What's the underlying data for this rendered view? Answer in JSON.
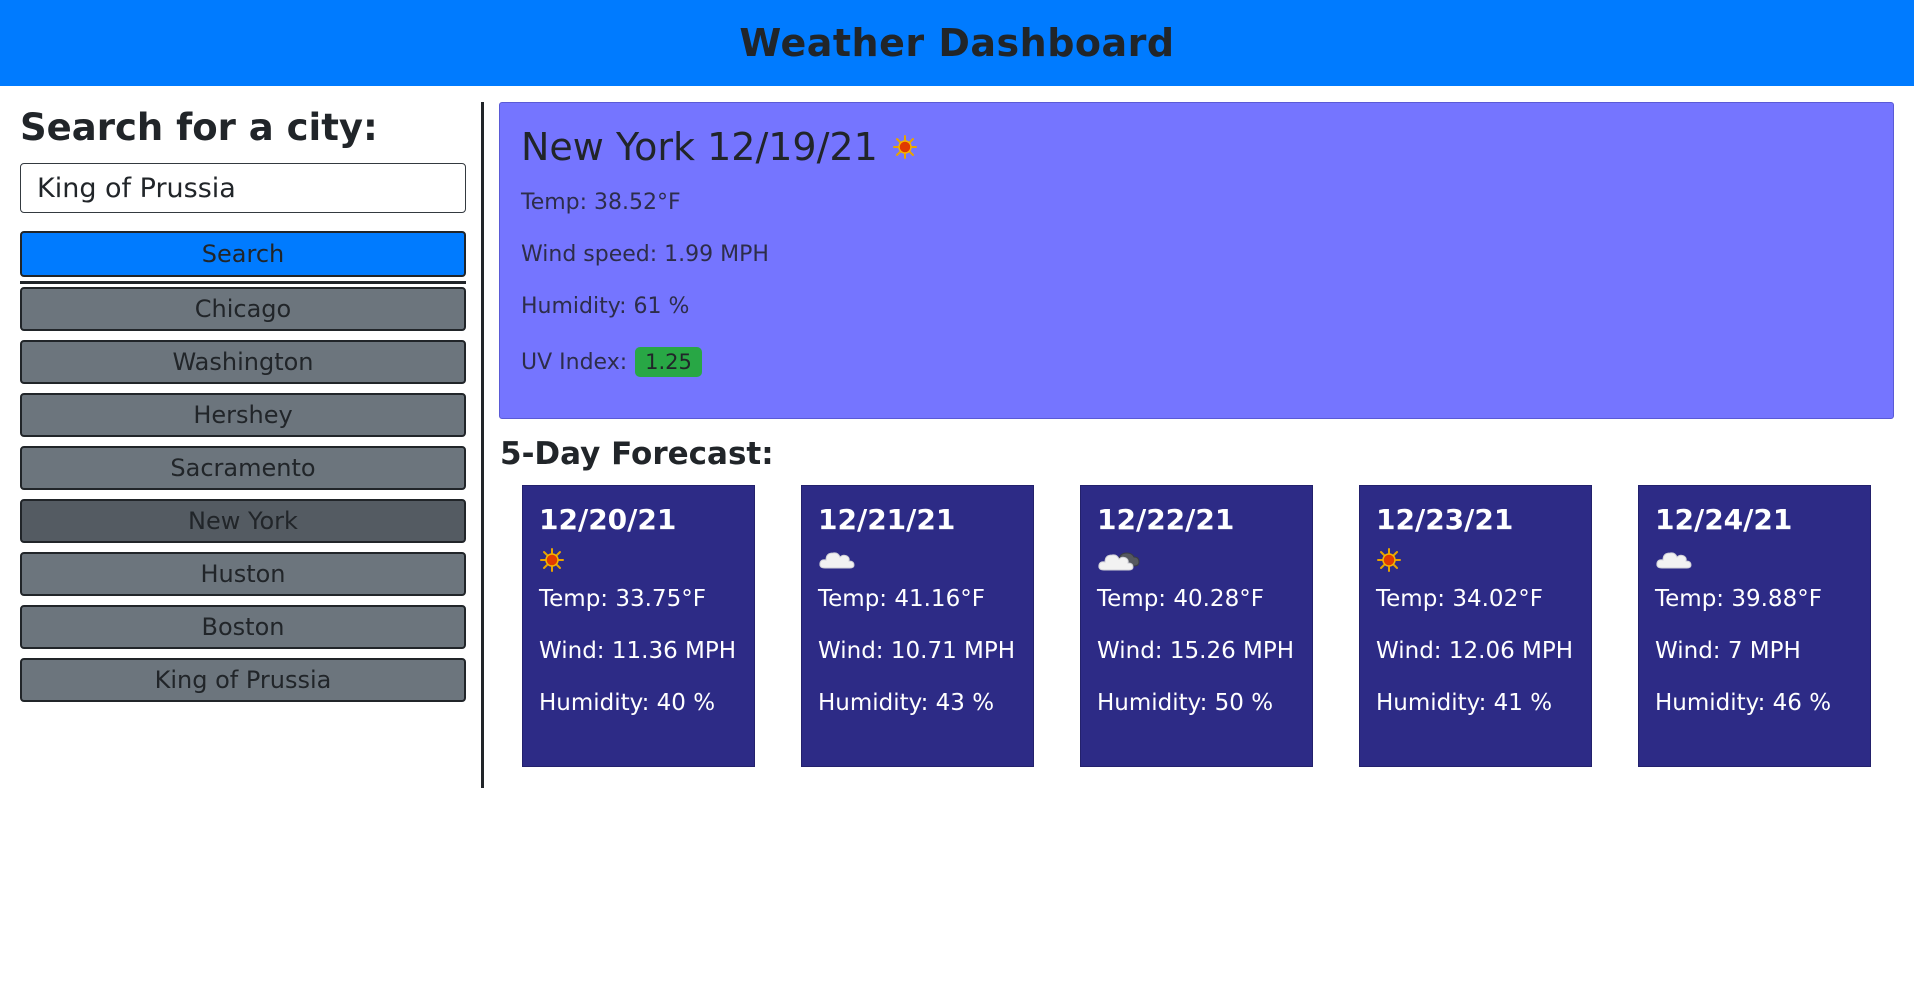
{
  "header": {
    "title": "Weather Dashboard"
  },
  "sidebar": {
    "heading": "Search for a city:",
    "search": {
      "value": "King of Prussia",
      "button_label": "Search"
    },
    "cities": [
      {
        "label": "Chicago",
        "active": false
      },
      {
        "label": "Washington",
        "active": false
      },
      {
        "label": "Hershey",
        "active": false
      },
      {
        "label": "Sacramento",
        "active": false
      },
      {
        "label": "New York",
        "active": true
      },
      {
        "label": "Huston",
        "active": false
      },
      {
        "label": "Boston",
        "active": false
      },
      {
        "label": "King of Prussia",
        "active": false
      }
    ]
  },
  "current": {
    "title": "New York 12/19/21",
    "icon": "sun-icon",
    "temp": "Temp: 38.52°F",
    "wind": "Wind speed: 1.99 MPH",
    "humidity": "Humidity: 61 %",
    "uv_label": "UV Index:",
    "uv_value": "1.25",
    "uv_color": "#28a745"
  },
  "forecast": {
    "heading": "5-Day Forecast:",
    "days": [
      {
        "date": "12/20/21",
        "icon": "sun-icon",
        "temp": "Temp: 33.75°F",
        "wind": "Wind: 11.36 MPH",
        "humidity": "Humidity: 40 %"
      },
      {
        "date": "12/21/21",
        "icon": "cloud-icon",
        "temp": "Temp: 41.16°F",
        "wind": "Wind: 10.71 MPH",
        "humidity": "Humidity: 43 %"
      },
      {
        "date": "12/22/21",
        "icon": "cloud-night-icon",
        "temp": "Temp: 40.28°F",
        "wind": "Wind: 15.26 MPH",
        "humidity": "Humidity: 50 %"
      },
      {
        "date": "12/23/21",
        "icon": "sun-icon",
        "temp": "Temp: 34.02°F",
        "wind": "Wind: 12.06 MPH",
        "humidity": "Humidity: 41 %"
      },
      {
        "date": "12/24/21",
        "icon": "cloud-icon",
        "temp": "Temp: 39.88°F",
        "wind": "Wind: 7 MPH",
        "humidity": "Humidity: 46 %"
      }
    ]
  },
  "colors": {
    "header_bg": "#007bff",
    "current_card_bg": "#7575ff",
    "forecast_card_bg": "#2d2b86",
    "city_button_bg": "#6c757d",
    "city_button_active_bg": "#545b62"
  }
}
